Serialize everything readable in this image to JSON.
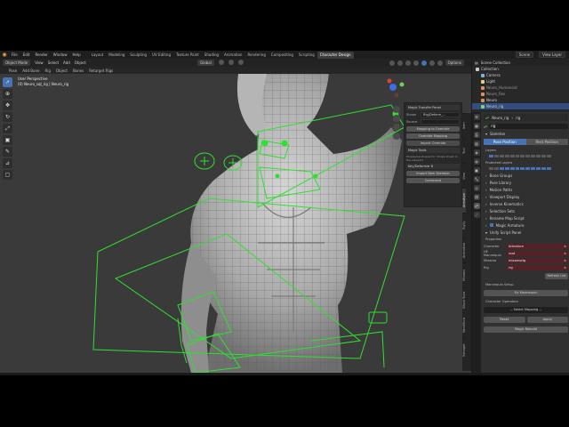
{
  "app": {
    "accent": "#4772b3",
    "rig_color": "#2fe02f",
    "mesh_color": "#c8c8c8"
  },
  "menubar": {
    "menus": [
      "File",
      "Edit",
      "Render",
      "Window",
      "Help"
    ],
    "workspaces": [
      "Layout",
      "Modeling",
      "Sculpting",
      "UV Editing",
      "Texture Paint",
      "Shading",
      "Animation",
      "Rendering",
      "Compositing",
      "Scripting",
      "Character Design"
    ],
    "active_workspace": "Character Design",
    "scene_field": "Scene",
    "layer_field": "View Layer"
  },
  "viewport_header": {
    "mode": "Object Mode",
    "menus": [
      "View",
      "Select",
      "Add",
      "Object"
    ],
    "transform": "Global",
    "options": "Options"
  },
  "viewport_subheader": {
    "items": [
      "Pose",
      "Add Bone",
      "Rig",
      "Object",
      "Bones",
      "Retarget Rigs"
    ]
  },
  "viewport_info": {
    "view_label": "User Perspective",
    "object_label": "(0) Neuro_sql_rig | Neuro_rig"
  },
  "npanel": {
    "title": "Magic Transfer Panel",
    "shape_label": "Shape",
    "shape_value": "Rig|Deform_...",
    "source_label": "Source",
    "rows": [
      "Mapping to Override",
      "Override Mapping"
    ],
    "apply_button": "Import Override",
    "section_2": "Magic Tools",
    "note": "Displaying shapes for: Shape shown in the viewport",
    "section_3": "Key/Deformer 6",
    "import_button": "Import New Skeleton",
    "bottom_button": "Command"
  },
  "vertical_tabs": [
    "Item",
    "Tool",
    "View",
    "Edit",
    "Armature",
    "Rigify",
    "Animation",
    "Mixamo",
    "Ghost Tools",
    "MeshTools",
    "Mask",
    "Retarget",
    "Auto-Rig"
  ],
  "active_vertical_tab": "Armature",
  "outliner": {
    "header": "Scene Collection",
    "items": [
      "Collection",
      "Camera",
      "Light",
      "Neuro_Humanoid",
      "Neuro_Res",
      "Neuro",
      "Neuro_rig"
    ]
  },
  "properties": {
    "object_name": "Neuro_rig",
    "data_name": "rig",
    "skeleton_label": "Skeleton",
    "pose_position": "Pose Position",
    "rest_position": "Rest Position",
    "layers_label": "Layers",
    "protected_layers_label": "Protected Layers",
    "sections": [
      "Bone Groups",
      "Pose Library",
      "Motion Paths",
      "Viewport Display",
      "Inverse Kinematics",
      "Selection Sets",
      "Custom Properties"
    ],
    "sub_sections": [
      "Rename Map Script",
      "Magic Armature",
      "Unify Script Panel"
    ],
    "properties_label": "Properties",
    "fields": [
      {
        "key": "Character",
        "value": "Armature"
      },
      {
        "key": "UE Mannequin",
        "value": "root"
      },
      {
        "key": "Mixamo",
        "value": "mixamorig"
      },
      {
        "key": "Rig",
        "value": "rig"
      }
    ],
    "refresh_button": "Refresh List",
    "mannequin_setup": "Mannequin Setup",
    "mannequin_button": "Fix Mannequin",
    "char_ops": "Character Operators",
    "select_mapping": "-- Select Mapping --",
    "reset_button": "Reset",
    "apply_button": "Apply",
    "magic_button": "Magic Rebuild"
  }
}
